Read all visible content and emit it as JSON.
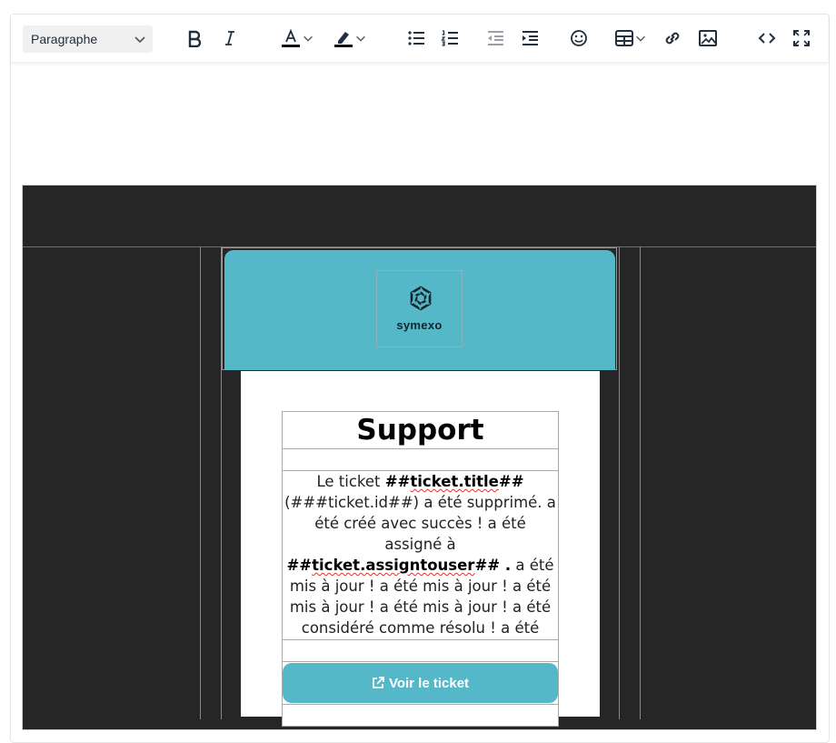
{
  "toolbar": {
    "block_format": "Paragraphe",
    "buttons": [
      "bold",
      "italic",
      "text-color",
      "highlight-color",
      "bullet-list",
      "numbered-list",
      "outdent",
      "indent",
      "emoji",
      "table",
      "link",
      "image",
      "source-code",
      "fullscreen"
    ]
  },
  "email": {
    "brand": "symexo",
    "title": "Support",
    "body": {
      "t1": "Le ticket ",
      "b1": "##",
      "s1": "ticket.title",
      "b2": "##",
      "t2": " (###ticket.id##) a été supprimé. a été créé avec succès ! a été assigné à ",
      "b3": "##",
      "s2": "ticket.assigntouser",
      "b4": "## .",
      "t3": " a été mis à jour ! a été mis à jour ! a été mis à jour ! a été mis à jour ! a été considéré comme résolu ! a été considéré comme résolu !"
    },
    "button_label": "Voir le ticket"
  },
  "colors": {
    "accent": "#55b8c9",
    "canvas_bg": "#262626",
    "toolbar_icon": "#222f3e"
  }
}
